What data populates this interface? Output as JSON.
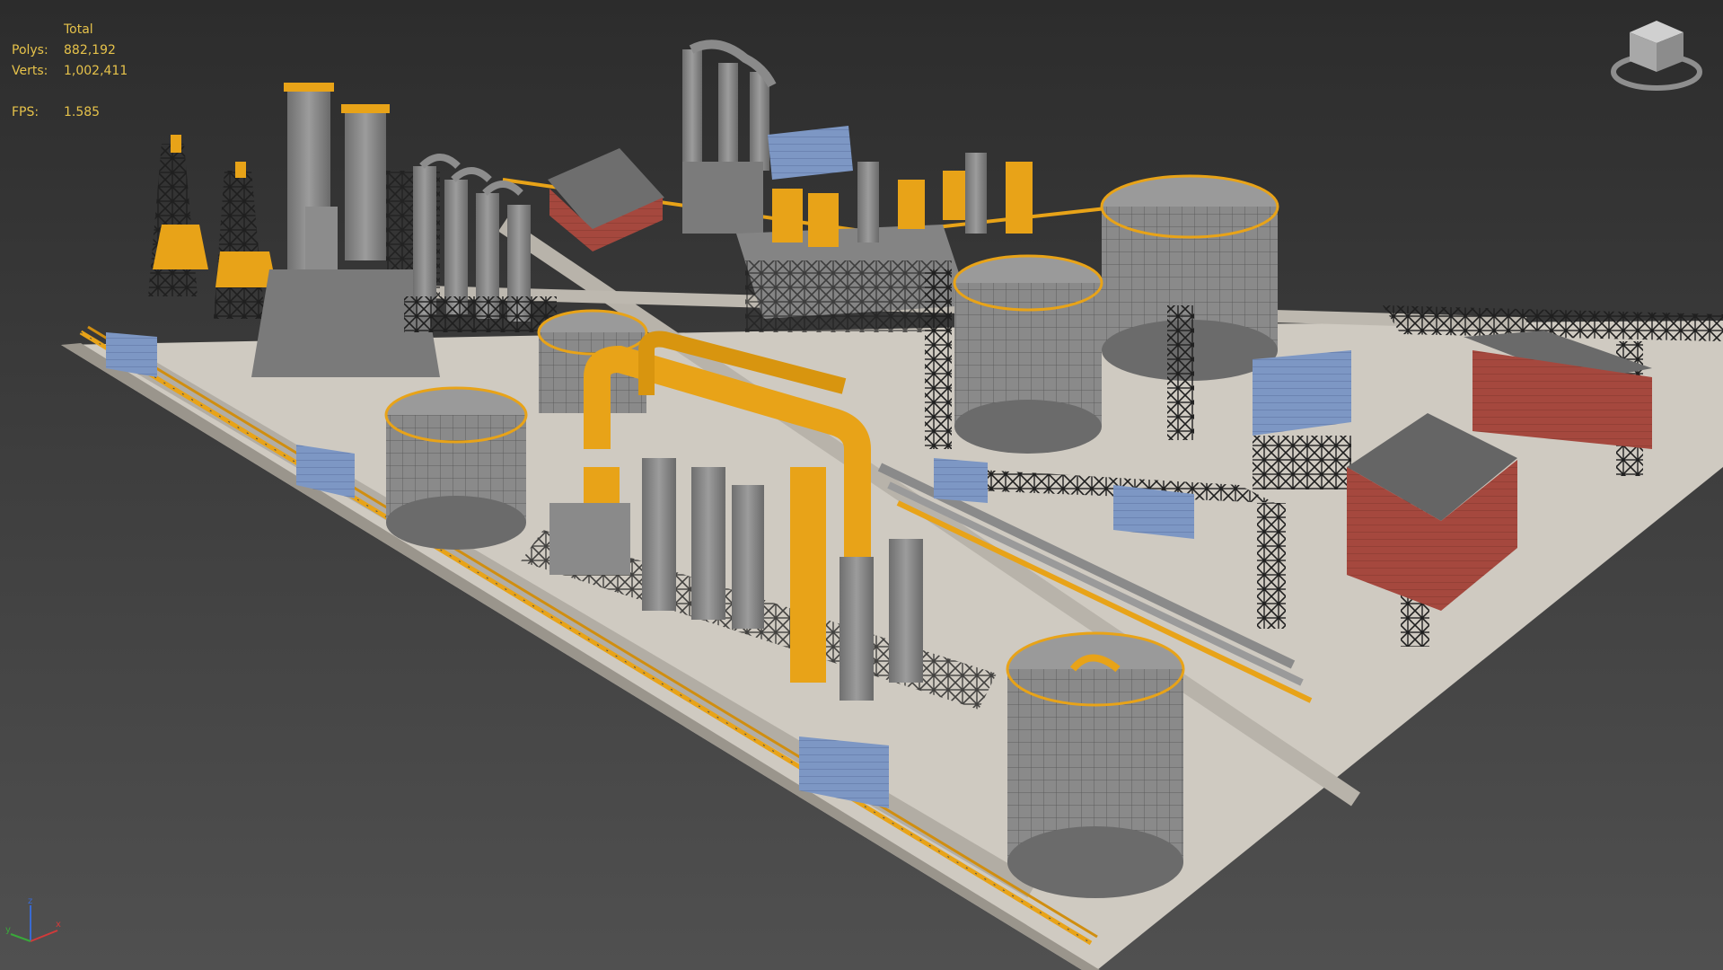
{
  "stats": {
    "header": "Total",
    "polys_label": "Polys:",
    "polys_value": "882,192",
    "verts_label": "Verts:",
    "verts_value": "1,002,411",
    "fps_label": "FPS:",
    "fps_value": "1.585"
  },
  "axis": {
    "x_label": "x",
    "y_label": "y",
    "z_label": "z"
  },
  "colors": {
    "background_top": "#2c2c2c",
    "background_bottom": "#505050",
    "stats_text": "#e6c24a",
    "ground": "#c9c4bb",
    "structure_gray": "#8e8e8e",
    "accent_yellow": "#e8a318",
    "steel_frame": "#2a2a2a",
    "brick_red": "#a24a40",
    "panel_blue": "#6f8bb8",
    "axis_x": "#d23a3a",
    "axis_y": "#3aa83a",
    "axis_z": "#3a6ad2"
  },
  "icons": {
    "viewcube": "viewcube-icon",
    "axis": "axis-tripod-icon"
  }
}
